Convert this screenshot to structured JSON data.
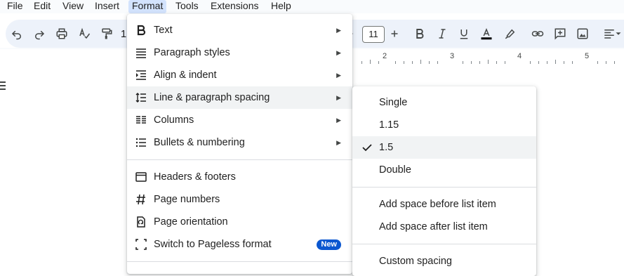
{
  "menubar": {
    "items": [
      "File",
      "Edit",
      "View",
      "Insert",
      "Format",
      "Tools",
      "Extensions",
      "Help"
    ],
    "active": "Format"
  },
  "toolbar": {
    "zoom_partial": "1",
    "font_size": "11"
  },
  "ruler": {
    "labels": [
      "2",
      "3",
      "4",
      "5"
    ]
  },
  "format_menu": {
    "items": [
      {
        "label": "Text",
        "icon": "bold-icon",
        "submenu": true
      },
      {
        "label": "Paragraph styles",
        "icon": "paragraph-styles-icon",
        "submenu": true
      },
      {
        "label": "Align & indent",
        "icon": "indent-icon",
        "submenu": true
      },
      {
        "label": "Line & paragraph spacing",
        "icon": "line-spacing-icon",
        "submenu": true,
        "highlighted": true
      },
      {
        "label": "Columns",
        "icon": "columns-icon",
        "submenu": true
      },
      {
        "label": "Bullets & numbering",
        "icon": "bulleted-list-icon",
        "submenu": true
      },
      {
        "label": "Headers & footers",
        "icon": "header-footer-icon"
      },
      {
        "label": "Page numbers",
        "icon": "hash-icon"
      },
      {
        "label": "Page orientation",
        "icon": "page-orientation-icon"
      },
      {
        "label": "Switch to Pageless format",
        "icon": "pageless-icon",
        "badge": "New"
      }
    ]
  },
  "spacing_menu": {
    "items": [
      {
        "label": "Single"
      },
      {
        "label": "1.15"
      },
      {
        "label": "1.5",
        "checked": true,
        "highlighted": true
      },
      {
        "label": "Double"
      },
      {
        "label": "Add space before list item"
      },
      {
        "label": "Add space after list item"
      },
      {
        "label": "Custom spacing"
      }
    ]
  },
  "colors": {
    "accent": "#0b57d0",
    "menubar_active": "#d3e3fd",
    "toolbar_bg": "#edf2fa",
    "highlight": "#f1f3f4"
  }
}
